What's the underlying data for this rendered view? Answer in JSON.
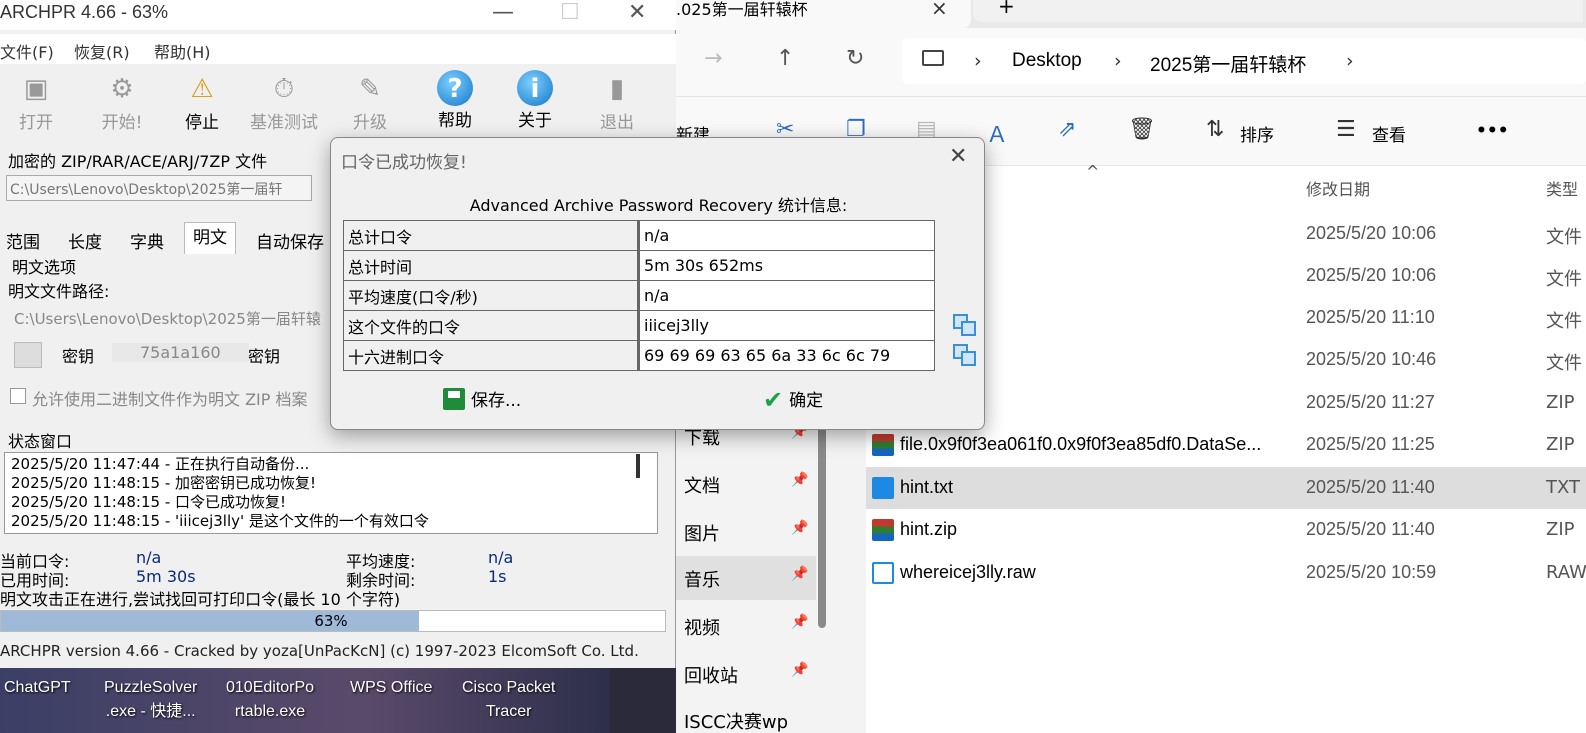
{
  "explorer": {
    "tab_title": ".025第一届轩辕杯",
    "close_icon": "×",
    "new_tab_icon": "+",
    "breadcrumb": [
      "Desktop",
      "2025第一届轩辕杯"
    ],
    "breadcrumb_sep": "›",
    "cmd": {
      "new": "新建",
      "sort": "排序",
      "view": "查看",
      "more": "•••"
    },
    "columns": {
      "sort_arrow": "^",
      "date": "修改日期",
      "type": "类型"
    },
    "nav_items": [
      {
        "label": "下载",
        "pin": "📌"
      },
      {
        "label": "文档",
        "pin": "📌"
      },
      {
        "label": "图片",
        "pin": "📌"
      },
      {
        "label": "音乐",
        "pin": "📌"
      },
      {
        "label": "视频",
        "pin": "📌"
      },
      {
        "label": "回收站",
        "pin": "📌"
      },
      {
        "label": "ISCC决赛wp",
        "pin": ""
      }
    ],
    "files": [
      {
        "name": "",
        "date": "2025/5/20 10:06",
        "type": "文件"
      },
      {
        "name": "",
        "date": "2025/5/20 10:06",
        "type": "文件"
      },
      {
        "name": "",
        "date": "2025/5/20 11:10",
        "type": "文件"
      },
      {
        "name": "",
        "date": "2025/5/20 10:46",
        "type": "文件"
      },
      {
        "name": "",
        "date": "2025/5/20 11:27",
        "type": "ZIP"
      },
      {
        "name": "file.0x9f0f3ea061f0.0x9f0f3ea85df0.DataSe...",
        "date": "2025/5/20 11:25",
        "type": "ZIP"
      },
      {
        "name": "hint.txt",
        "date": "2025/5/20 11:40",
        "type": "TXT"
      },
      {
        "name": "hint.zip",
        "date": "2025/5/20 11:40",
        "type": "ZIP"
      },
      {
        "name": "whereicej3lly.raw",
        "date": "2025/5/20 10:59",
        "type": "RAW"
      }
    ]
  },
  "archpr": {
    "title": "ARCHPR 4.66 - 63%",
    "menu": [
      "文件(F)",
      "恢复(R)",
      "帮助(H)"
    ],
    "toolbar": [
      "打开",
      "开始!",
      "停止",
      "基准测试",
      "升级",
      "帮助",
      "关于",
      "退出"
    ],
    "toolbar_glyphs": {
      "help": "?",
      "about": "i"
    },
    "file_label": "加密的 ZIP/RAR/ACE/ARJ/7ZP 文件",
    "file_path": "C:\\Users\\Lenovo\\Desktop\\2025第一届轩",
    "tabs": [
      "范围",
      "长度",
      "字典",
      "明文",
      "自动保存"
    ],
    "plaintext": {
      "group": "明文选项",
      "path_label": "明文文件路径:",
      "path": "C:\\Users\\Lenovo\\Desktop\\2025第一届轩辕",
      "key_label": "密钥",
      "key1": "75a1a160",
      "key2_label": "密钥",
      "allow_binary": "允许使用二进制文件作为明文 ZIP 档案"
    },
    "status_label": "状态窗口",
    "log": [
      "2025/5/20 11:47:44 - 正在执行自动备份...",
      "2025/5/20 11:48:15 - 加密密钥已成功恢复!",
      "2025/5/20 11:48:15 - 口令已成功恢复!",
      "2025/5/20 11:48:15 - 'iiicej3lly' 是这个文件的一个有效口令"
    ],
    "current_pw_label": "当前口令:",
    "current_pw": "n/a",
    "avg_speed_label": "平均速度:",
    "avg_speed": "n/a",
    "elapsed_label": "已用时间:",
    "elapsed": "5m 30s",
    "remaining_label": "剩余时间:",
    "remaining": "1s",
    "attack_info": "明文攻击正在进行,尝试找回可打印口令(最长 10 个字符)",
    "progress_percent": 63,
    "progress_text": "63%",
    "statusbar": "ARCHPR version 4.66  - Cracked by yoza[UnPacKcN] (c) 1997-2023 ElcomSoft Co. Ltd."
  },
  "dialog": {
    "title": "口令已成功恢复!",
    "close_icon": "✕",
    "header": "Advanced Archive Password Recovery 统计信息:",
    "rows": [
      {
        "k": "总计口令",
        "v": "n/a"
      },
      {
        "k": "总计时间",
        "v": "5m 30s 652ms"
      },
      {
        "k": "平均速度(口令/秒)",
        "v": "n/a"
      },
      {
        "k": "这个文件的口令",
        "v": "iiicej3lly"
      },
      {
        "k": "十六进制口令",
        "v": "69 69 69 63 65 6a 33 6c 6c 79"
      }
    ],
    "save_label": "保存...",
    "ok_label": "确定",
    "ok_glyph": "✔"
  },
  "desktop": {
    "icons": [
      {
        "label": "ChatGPT"
      },
      {
        "label": "PuzzleSolver\n.exe - 快捷..."
      },
      {
        "label": "010EditorPo\nrtable.exe"
      },
      {
        "label": "WPS Office"
      },
      {
        "label": "Cisco Packet\nTracer"
      }
    ]
  },
  "colors": {
    "accent": "#2b6cc4",
    "progress": "#9fb9d8",
    "selected": "#dddddd"
  }
}
